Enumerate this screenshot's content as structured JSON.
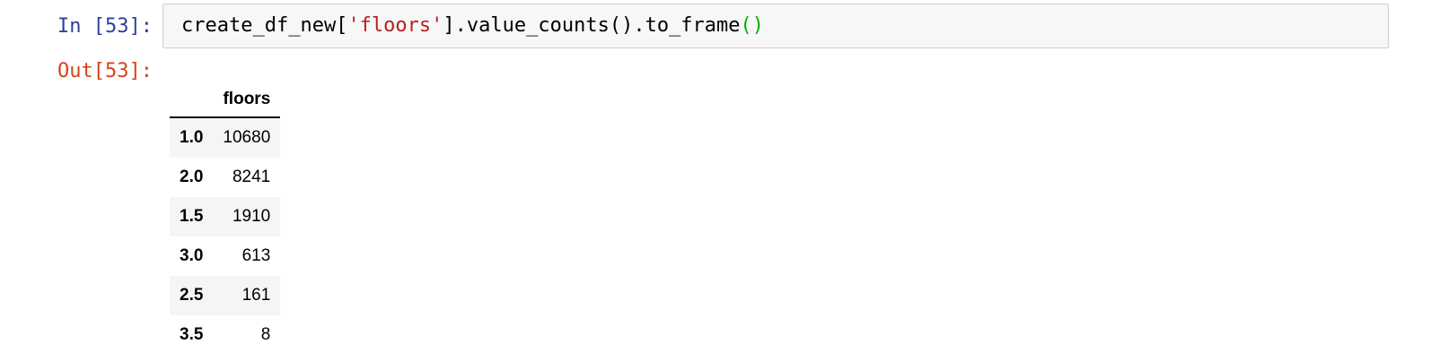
{
  "cell": {
    "input_prompt": "In [53]:",
    "output_prompt": "Out[53]:",
    "code": {
      "part1": "create_df_new[",
      "string": "'floors'",
      "part2": "].value_counts().to_frame",
      "parens": "()"
    }
  },
  "table": {
    "index_header": "",
    "column_header": "floors",
    "rows": [
      {
        "index": "1.0",
        "value": "10680"
      },
      {
        "index": "2.0",
        "value": "8241"
      },
      {
        "index": "1.5",
        "value": "1910"
      },
      {
        "index": "3.0",
        "value": "613"
      },
      {
        "index": "2.5",
        "value": "161"
      },
      {
        "index": "3.5",
        "value": "8"
      }
    ]
  },
  "colors": {
    "input_prompt": "#303f9f",
    "output_prompt": "#d84315",
    "string_token": "#ba2121",
    "paren_token": "#00b000"
  }
}
